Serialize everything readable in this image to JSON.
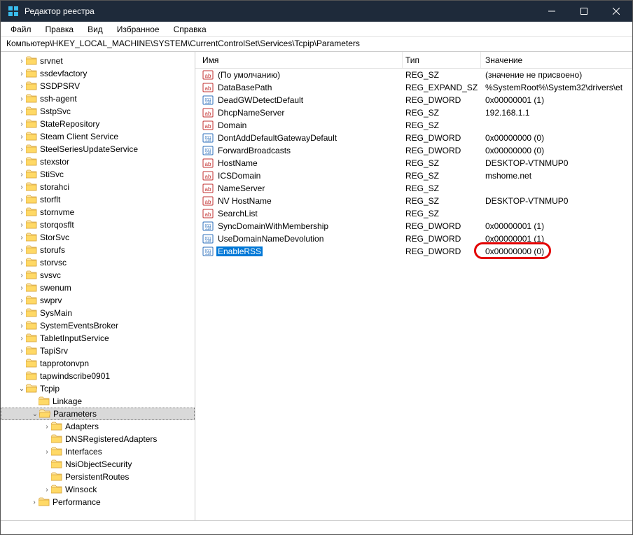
{
  "title": "Редактор реестра",
  "menu": [
    "Файл",
    "Правка",
    "Вид",
    "Избранное",
    "Справка"
  ],
  "address": "Компьютер\\HKEY_LOCAL_MACHINE\\SYSTEM\\CurrentControlSet\\Services\\Tcpip\\Parameters",
  "columns": {
    "name": "Имя",
    "type": "Тип",
    "value": "Значение"
  },
  "tree": [
    {
      "indent": 1,
      "chev": ">",
      "open": false,
      "label": "srvnet"
    },
    {
      "indent": 1,
      "chev": ">",
      "open": false,
      "label": "ssdevfactory"
    },
    {
      "indent": 1,
      "chev": ">",
      "open": false,
      "label": "SSDPSRV"
    },
    {
      "indent": 1,
      "chev": ">",
      "open": false,
      "label": "ssh-agent"
    },
    {
      "indent": 1,
      "chev": ">",
      "open": false,
      "label": "SstpSvc"
    },
    {
      "indent": 1,
      "chev": ">",
      "open": false,
      "label": "StateRepository"
    },
    {
      "indent": 1,
      "chev": ">",
      "open": false,
      "label": "Steam Client Service"
    },
    {
      "indent": 1,
      "chev": ">",
      "open": false,
      "label": "SteelSeriesUpdateService"
    },
    {
      "indent": 1,
      "chev": ">",
      "open": false,
      "label": "stexstor"
    },
    {
      "indent": 1,
      "chev": ">",
      "open": false,
      "label": "StiSvc"
    },
    {
      "indent": 1,
      "chev": ">",
      "open": false,
      "label": "storahci"
    },
    {
      "indent": 1,
      "chev": ">",
      "open": false,
      "label": "storflt"
    },
    {
      "indent": 1,
      "chev": ">",
      "open": false,
      "label": "stornvme"
    },
    {
      "indent": 1,
      "chev": ">",
      "open": false,
      "label": "storqosflt"
    },
    {
      "indent": 1,
      "chev": ">",
      "open": false,
      "label": "StorSvc"
    },
    {
      "indent": 1,
      "chev": ">",
      "open": false,
      "label": "storufs"
    },
    {
      "indent": 1,
      "chev": ">",
      "open": false,
      "label": "storvsc"
    },
    {
      "indent": 1,
      "chev": ">",
      "open": false,
      "label": "svsvc"
    },
    {
      "indent": 1,
      "chev": ">",
      "open": false,
      "label": "swenum"
    },
    {
      "indent": 1,
      "chev": ">",
      "open": false,
      "label": "swprv"
    },
    {
      "indent": 1,
      "chev": ">",
      "open": false,
      "label": "SysMain"
    },
    {
      "indent": 1,
      "chev": ">",
      "open": false,
      "label": "SystemEventsBroker"
    },
    {
      "indent": 1,
      "chev": ">",
      "open": false,
      "label": "TabletInputService"
    },
    {
      "indent": 1,
      "chev": ">",
      "open": false,
      "label": "TapiSrv"
    },
    {
      "indent": 1,
      "chev": "",
      "open": false,
      "label": "tapprotonvpn"
    },
    {
      "indent": 1,
      "chev": "",
      "open": false,
      "label": "tapwindscribe0901"
    },
    {
      "indent": 1,
      "chev": "v",
      "open": true,
      "label": "Tcpip"
    },
    {
      "indent": 2,
      "chev": "",
      "open": false,
      "label": "Linkage"
    },
    {
      "indent": 2,
      "chev": "v",
      "open": true,
      "label": "Parameters",
      "selected": true
    },
    {
      "indent": 3,
      "chev": ">",
      "open": false,
      "label": "Adapters"
    },
    {
      "indent": 3,
      "chev": "",
      "open": false,
      "label": "DNSRegisteredAdapters"
    },
    {
      "indent": 3,
      "chev": ">",
      "open": false,
      "label": "Interfaces"
    },
    {
      "indent": 3,
      "chev": "",
      "open": false,
      "label": "NsiObjectSecurity"
    },
    {
      "indent": 3,
      "chev": "",
      "open": false,
      "label": "PersistentRoutes"
    },
    {
      "indent": 3,
      "chev": ">",
      "open": false,
      "label": "Winsock"
    },
    {
      "indent": 2,
      "chev": ">",
      "open": false,
      "label": "Performance"
    }
  ],
  "values": [
    {
      "icon": "str",
      "name": "(По умолчанию)",
      "type": "REG_SZ",
      "val": "(значение не присвоено)"
    },
    {
      "icon": "str",
      "name": "DataBasePath",
      "type": "REG_EXPAND_SZ",
      "val": "%SystemRoot%\\System32\\drivers\\et"
    },
    {
      "icon": "bin",
      "name": "DeadGWDetectDefault",
      "type": "REG_DWORD",
      "val": "0x00000001 (1)"
    },
    {
      "icon": "str",
      "name": "DhcpNameServer",
      "type": "REG_SZ",
      "val": "192.168.1.1"
    },
    {
      "icon": "str",
      "name": "Domain",
      "type": "REG_SZ",
      "val": ""
    },
    {
      "icon": "bin",
      "name": "DontAddDefaultGatewayDefault",
      "type": "REG_DWORD",
      "val": "0x00000000 (0)"
    },
    {
      "icon": "bin",
      "name": "ForwardBroadcasts",
      "type": "REG_DWORD",
      "val": "0x00000000 (0)"
    },
    {
      "icon": "str",
      "name": "HostName",
      "type": "REG_SZ",
      "val": "DESKTOP-VTNMUP0"
    },
    {
      "icon": "str",
      "name": "ICSDomain",
      "type": "REG_SZ",
      "val": "mshome.net"
    },
    {
      "icon": "str",
      "name": "NameServer",
      "type": "REG_SZ",
      "val": ""
    },
    {
      "icon": "str",
      "name": "NV HostName",
      "type": "REG_SZ",
      "val": "DESKTOP-VTNMUP0"
    },
    {
      "icon": "str",
      "name": "SearchList",
      "type": "REG_SZ",
      "val": ""
    },
    {
      "icon": "bin",
      "name": "SyncDomainWithMembership",
      "type": "REG_DWORD",
      "val": "0x00000001 (1)"
    },
    {
      "icon": "bin",
      "name": "UseDomainNameDevolution",
      "type": "REG_DWORD",
      "val": "0x00000001 (1)"
    },
    {
      "icon": "bin",
      "name": "EnableRSS",
      "type": "REG_DWORD",
      "val": "0x00000000 (0)",
      "selected": true,
      "highlight": true
    }
  ]
}
